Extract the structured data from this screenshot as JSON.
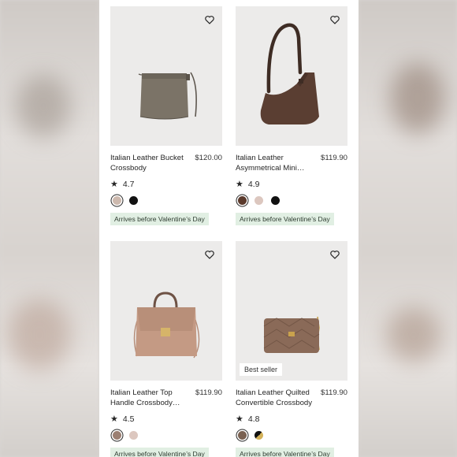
{
  "products": [
    {
      "title": "Italian Leather Bucket Crossbody",
      "price": "$120.00",
      "rating": "4.7",
      "badge": "",
      "arrival": "Arrives before Valentine’s Day",
      "swatches": [
        "#cdb9ae",
        "#111111"
      ],
      "selected_swatch": 0
    },
    {
      "title": "Italian Leather Asymmetrical Mini…",
      "price": "$119.90",
      "rating": "4.9",
      "badge": "",
      "arrival": "Arrives before Valentine’s Day",
      "swatches": [
        "#5b3a2c",
        "#dcc7bf",
        "#111111"
      ],
      "selected_swatch": 0
    },
    {
      "title": "Italian Leather Top Handle Crossbody…",
      "price": "$119.90",
      "rating": "4.5",
      "badge": "",
      "arrival": "Arrives before Valentine’s Day",
      "swatches": [
        "#9b7f72",
        "#dcc7bf"
      ],
      "selected_swatch": 0
    },
    {
      "title": "Italian Leather Quilted Convertible Crossbody",
      "price": "$119.90",
      "rating": "4.8",
      "badge": "Best seller",
      "arrival": "Arrives before Valentine’s Day",
      "swatches": [
        "#7a6151",
        "split-black-gold"
      ],
      "selected_swatch": 0
    }
  ],
  "icons": {
    "favorite": "heart-outline-icon",
    "rating": "star-icon"
  },
  "colors": {
    "arrival_bg": "#e1efe3",
    "image_bg": "#ecebea"
  }
}
